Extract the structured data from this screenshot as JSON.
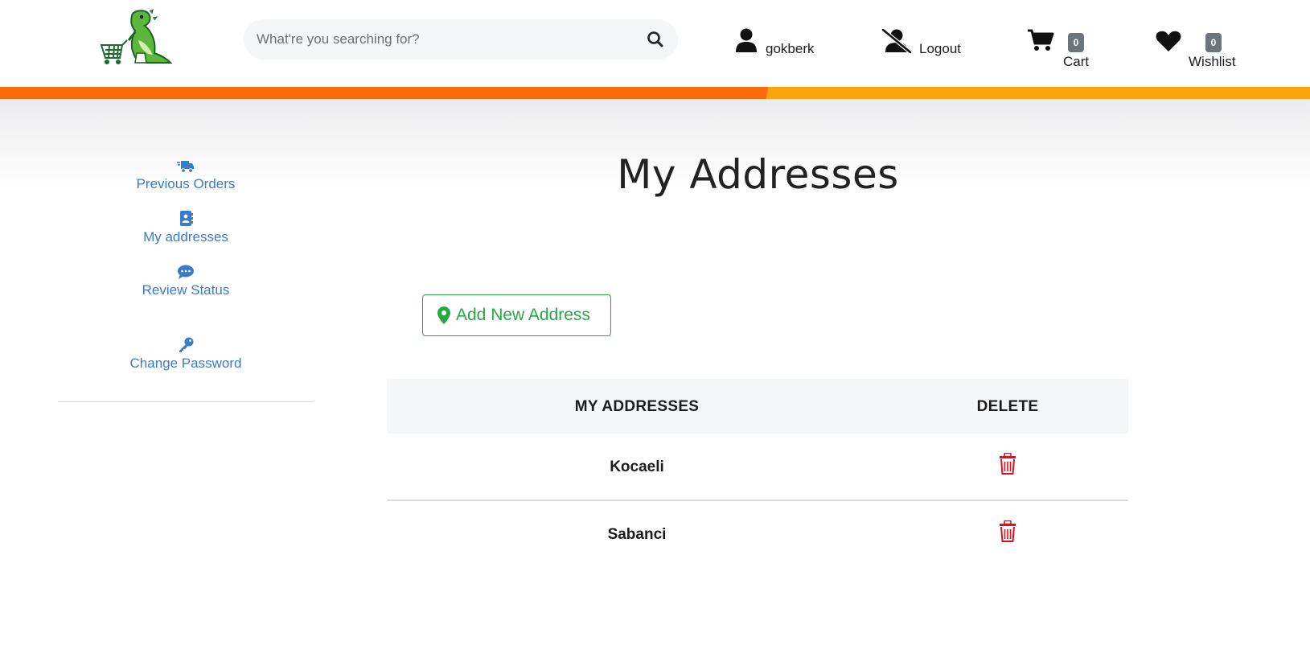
{
  "header": {
    "search_placeholder": "What're you searching for?",
    "username": "gokberk",
    "logout_label": "Logout",
    "cart_label": "Cart",
    "cart_count": "0",
    "wishlist_label": "Wishlist",
    "wishlist_count": "0"
  },
  "sidebar": {
    "items": [
      {
        "label": "Previous Orders",
        "icon": "truck-icon"
      },
      {
        "label": "My addresses",
        "icon": "address-book-icon"
      },
      {
        "label": "Review Status",
        "icon": "comment-icon"
      },
      {
        "label": "Change Password",
        "icon": "key-icon"
      }
    ]
  },
  "main": {
    "title": "My Addresses",
    "add_button_label": "Add New Address",
    "table": {
      "headers": [
        "MY ADDRESSES",
        "DELETE"
      ],
      "rows": [
        {
          "address": "Kocaeli"
        },
        {
          "address": "Sabanci"
        }
      ]
    }
  },
  "colors": {
    "accent_blue": "#3a7bc8",
    "accent_green": "#28a745",
    "delete_red": "#e3101f",
    "stripe_dark": "#fb6a0b",
    "stripe_light": "#fba40f"
  }
}
